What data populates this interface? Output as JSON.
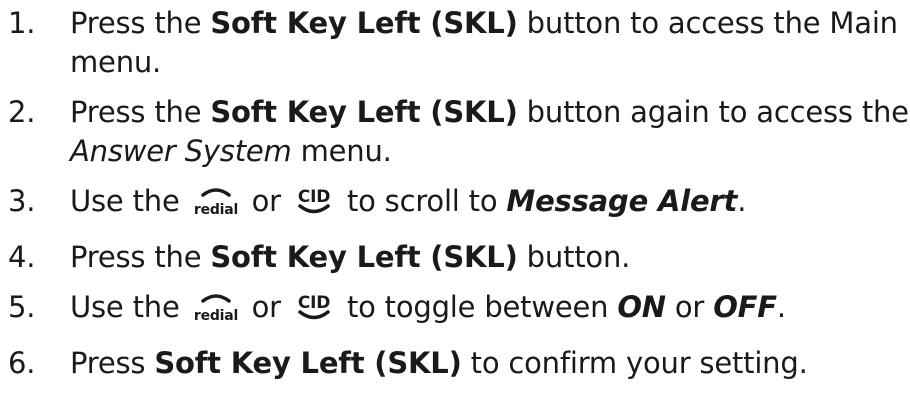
{
  "steps": [
    {
      "number": "1.",
      "line1_pre": "Press the ",
      "line1_bold": "Soft Key Left (SKL)",
      "line1_post": " button to access the Main",
      "line2": "menu."
    },
    {
      "number": "2.",
      "line1_pre": "Press the ",
      "line1_bold": "Soft Key Left (SKL)",
      "line1_post": " button again to access the",
      "line2_italic": "Answer System",
      "line2_post": " menu."
    },
    {
      "number": "3.",
      "pre": "Use the ",
      "icon1": "redial-icon",
      "or": " or ",
      "icon2": "cid-icon",
      "mid": " to scroll to ",
      "target": "Message Alert",
      "end": "."
    },
    {
      "number": "4.",
      "pre": "Press the ",
      "bold": "Soft Key Left (SKL)",
      "post": " button."
    },
    {
      "number": "5.",
      "pre": "Use the ",
      "icon1": "redial-icon",
      "or": " or ",
      "icon2": "cid-icon",
      "mid": " to toggle between ",
      "on": "ON",
      "or2": " or ",
      "off": "OFF",
      "end": "."
    },
    {
      "number": "6.",
      "pre": "Press ",
      "bold": "Soft Key Left (SKL)",
      "post": " to confirm your setting."
    }
  ],
  "icons": {
    "redial_text": "redial",
    "cid_text": "CID",
    "color": "#1a1a1a"
  }
}
